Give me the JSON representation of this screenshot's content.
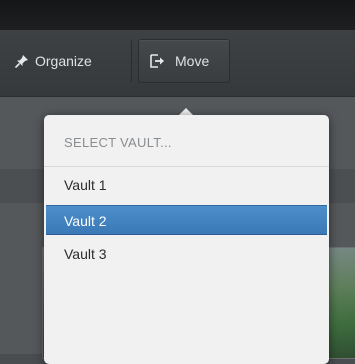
{
  "toolbar": {
    "organize_label": "Organize",
    "organize_icon": "pin-icon",
    "move_label": "Move",
    "move_icon": "move-to-icon"
  },
  "vault_menu": {
    "header": "SELECT VAULT...",
    "items": [
      {
        "label": "Vault 1",
        "selected": false
      },
      {
        "label": "Vault 2",
        "selected": true
      },
      {
        "label": "Vault 3",
        "selected": false
      }
    ]
  },
  "colors": {
    "toolbar_bg": "#3a3d40",
    "menu_bg": "#f1f1f1",
    "selection": "#3f7fbd",
    "menu_header_text": "#8a8d90"
  }
}
